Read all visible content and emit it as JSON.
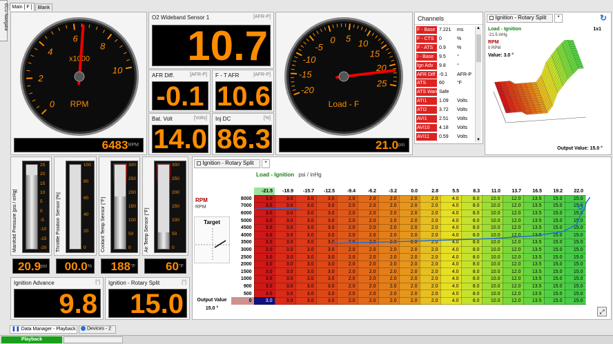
{
  "side_tab": "ECU Navigator",
  "tabs": [
    "Main [ F ]",
    "Blank"
  ],
  "rpm_gauge": {
    "label": "RPM",
    "multiplier": "x1000",
    "ticks": [
      "0",
      "2",
      "4",
      "6",
      "8",
      "10"
    ],
    "value": 6483,
    "unit": "RPM",
    "value_text": "6483"
  },
  "load_gauge": {
    "label": "Load - F",
    "ticks": [
      "-20",
      "-15",
      "-10",
      "-5",
      "0",
      "5",
      "10",
      "15",
      "20",
      "25"
    ],
    "value": 21.0,
    "unit": "psi",
    "value_text": "21.0"
  },
  "o2": {
    "title": "O2 Wideband Sensor 1",
    "unit": "[AFR-P]",
    "value": "10.7"
  },
  "afr_diff": {
    "title": "AFR Diff.",
    "unit": "[AFR-P]",
    "value": "-0.1"
  },
  "ft_afr": {
    "title": "F - T AFR",
    "unit": "[AFR-P]",
    "value": "10.6"
  },
  "bat": {
    "title": "Bat. Volt",
    "unit": "[Volts]",
    "value": "14.0"
  },
  "injdc": {
    "title": "Inj DC",
    "unit": "[%]",
    "value": "86.3"
  },
  "channels": {
    "title": "Channels",
    "rows": [
      {
        "name": "F - Base",
        "value": "7.221",
        "unit": "ms"
      },
      {
        "name": "F - CTS",
        "value": "0",
        "unit": "%"
      },
      {
        "name": "F - ATS",
        "value": "0.9",
        "unit": "%"
      },
      {
        "name": "I - Base",
        "value": "9.5",
        "unit": "°"
      },
      {
        "name": "Ign Adv",
        "value": "9.8",
        "unit": "°"
      },
      {
        "name": "AFR Diff",
        "value": "-0.1",
        "unit": "AFR-P"
      },
      {
        "name": "ATS",
        "value": "60",
        "unit": "°F"
      },
      {
        "name": "ATS Warn",
        "value": "Safe",
        "unit": ""
      },
      {
        "name": "ATI1",
        "value": "1.09",
        "unit": "Volts"
      },
      {
        "name": "ATI2",
        "value": "3.72",
        "unit": "Volts"
      },
      {
        "name": "AVI1",
        "value": "2.51",
        "unit": "Volts"
      },
      {
        "name": "AVI10",
        "value": "4.18",
        "unit": "Volts"
      },
      {
        "name": "AVI11",
        "value": "0.59",
        "unit": "Volts"
      }
    ]
  },
  "split3d": {
    "tab": "Ignition - Rotary Split",
    "tab2": "*",
    "load_label": "Load - Ignition",
    "load_value": "-21.5 inHg",
    "zoom": "1x1",
    "rpm_label": "RPM",
    "rpm_value": "0 RPM",
    "value_label": "Value: 3.0 °",
    "output": "Output Value: 15.0 °"
  },
  "bars": [
    {
      "title": "Manifold Pressure [psi / inHg]",
      "ticks": [
        "25",
        "20",
        "15",
        "10",
        "5",
        "0",
        "-5",
        "-10",
        "-15",
        "-20"
      ],
      "fill": 0.88,
      "value": "20.9",
      "unit": "psi"
    },
    {
      "title": "Throttle Position Sensor [%]",
      "ticks": [
        "100",
        "80",
        "60",
        "40",
        "20",
        "0"
      ],
      "fill": 0.0,
      "value": "00.0",
      "unit": "%"
    },
    {
      "title": "Coolant Temp Sensor [°F]",
      "ticks": [
        "300",
        "250",
        "200",
        "150",
        "100",
        "50",
        "0"
      ],
      "fill": 0.62,
      "value": "188",
      "unit": "°F"
    },
    {
      "title": "Air Temp Sensor [°F]",
      "ticks": [
        "300",
        "250",
        "200",
        "150",
        "100",
        "50",
        "0"
      ],
      "fill": 0.2,
      "value": "60",
      "unit": "°F"
    }
  ],
  "ign_adv": {
    "title": "Ignition Advance",
    "unit": "[°]",
    "value": "9.8"
  },
  "ign_split": {
    "title": "Ignition - Rotary Split",
    "unit": "[°]",
    "value": "15.0"
  },
  "table": {
    "tab": "Ignition - Rotary Split",
    "tab2": "*",
    "x_label": "Load - Ignition",
    "x_unit": "psi / inHg",
    "y_label": "RPM",
    "y_unit": "RPM",
    "target": "Target",
    "output_label": "Output Value",
    "output_value": "15.0 °",
    "cols": [
      "-21.5",
      "-18.9",
      "-15.7",
      "-12.5",
      "-9.4",
      "-6.2",
      "-3.2",
      "0.0",
      "2.8",
      "5.5",
      "8.3",
      "11.0",
      "13.7",
      "16.5",
      "19.2",
      "22.0"
    ],
    "rows": [
      "8000",
      "7000",
      "6000",
      "5000",
      "4500",
      "4000",
      "3500",
      "3000",
      "2500",
      "2000",
      "1500",
      "1000",
      "900",
      "500",
      "0"
    ],
    "row_values": [
      "3.0",
      "3.0",
      "3.0",
      "3.0",
      "2.0",
      "2.0",
      "2.0",
      "2.0",
      "2.0",
      "4.0",
      "8.0",
      "10.0",
      "12.0",
      "13.5",
      "15.0",
      "15.0"
    ]
  },
  "bottom": {
    "tab1": "Data Manager - Playback",
    "tab2": "Devices - 2",
    "status": "Playback"
  }
}
